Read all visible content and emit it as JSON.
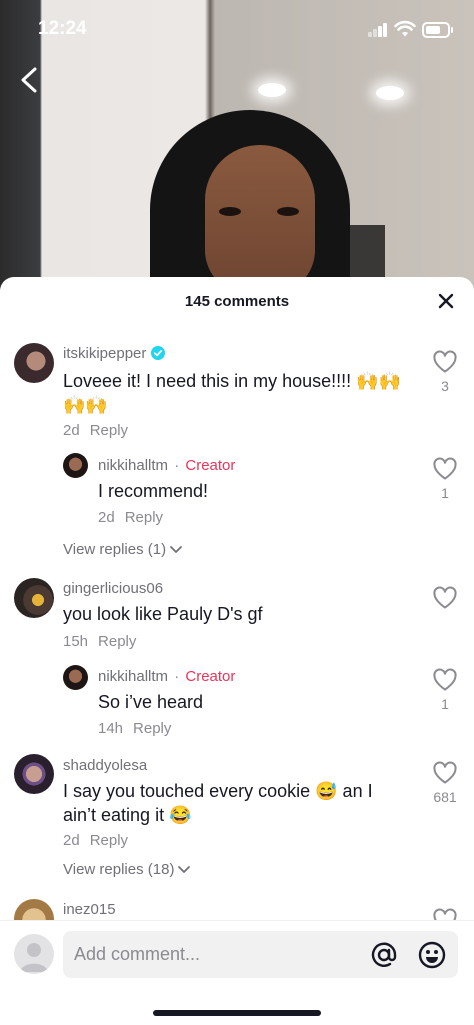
{
  "status_bar": {
    "time": "12:24"
  },
  "sheet": {
    "title": "145 comments"
  },
  "comments": [
    {
      "username": "itskikipepper",
      "verified": true,
      "text_line1": "Loveee it! I need this in my house!!!! 🙌🙌",
      "text_line2": "🙌🙌",
      "time": "2d",
      "reply_label": "Reply",
      "likes": "3",
      "reply": {
        "username": "nikkihalltm",
        "creator_label": "Creator",
        "text": "I recommend!",
        "time": "2d",
        "reply_label": "Reply",
        "likes": "1"
      },
      "view_replies": "View replies (1)"
    },
    {
      "username": "gingerlicious06",
      "text": "you look like Pauly D's gf",
      "time": "15h",
      "reply_label": "Reply",
      "likes": "",
      "reply": {
        "username": "nikkihalltm",
        "creator_label": "Creator",
        "text": "So i’ve heard",
        "time": "14h",
        "reply_label": "Reply",
        "likes": "1"
      }
    },
    {
      "username": "shaddyolesa",
      "text_line1": "I say you touched every cookie 😅 an I",
      "text_line2": "ain’t eating it 😂",
      "time": "2d",
      "reply_label": "Reply",
      "likes": "681",
      "view_replies": "View replies (18)"
    },
    {
      "username": "inez015"
    }
  ],
  "input": {
    "placeholder": "Add comment..."
  },
  "icons": {
    "back": "chevron-left-icon",
    "close": "close-icon",
    "like": "heart-outline-icon",
    "verified": "verified-badge-icon",
    "mention": "at-sign-icon",
    "emoji": "smiley-icon"
  },
  "colors": {
    "creator": "#e8355a",
    "verified": "#20d5ec",
    "muted": "#8a8b91"
  }
}
